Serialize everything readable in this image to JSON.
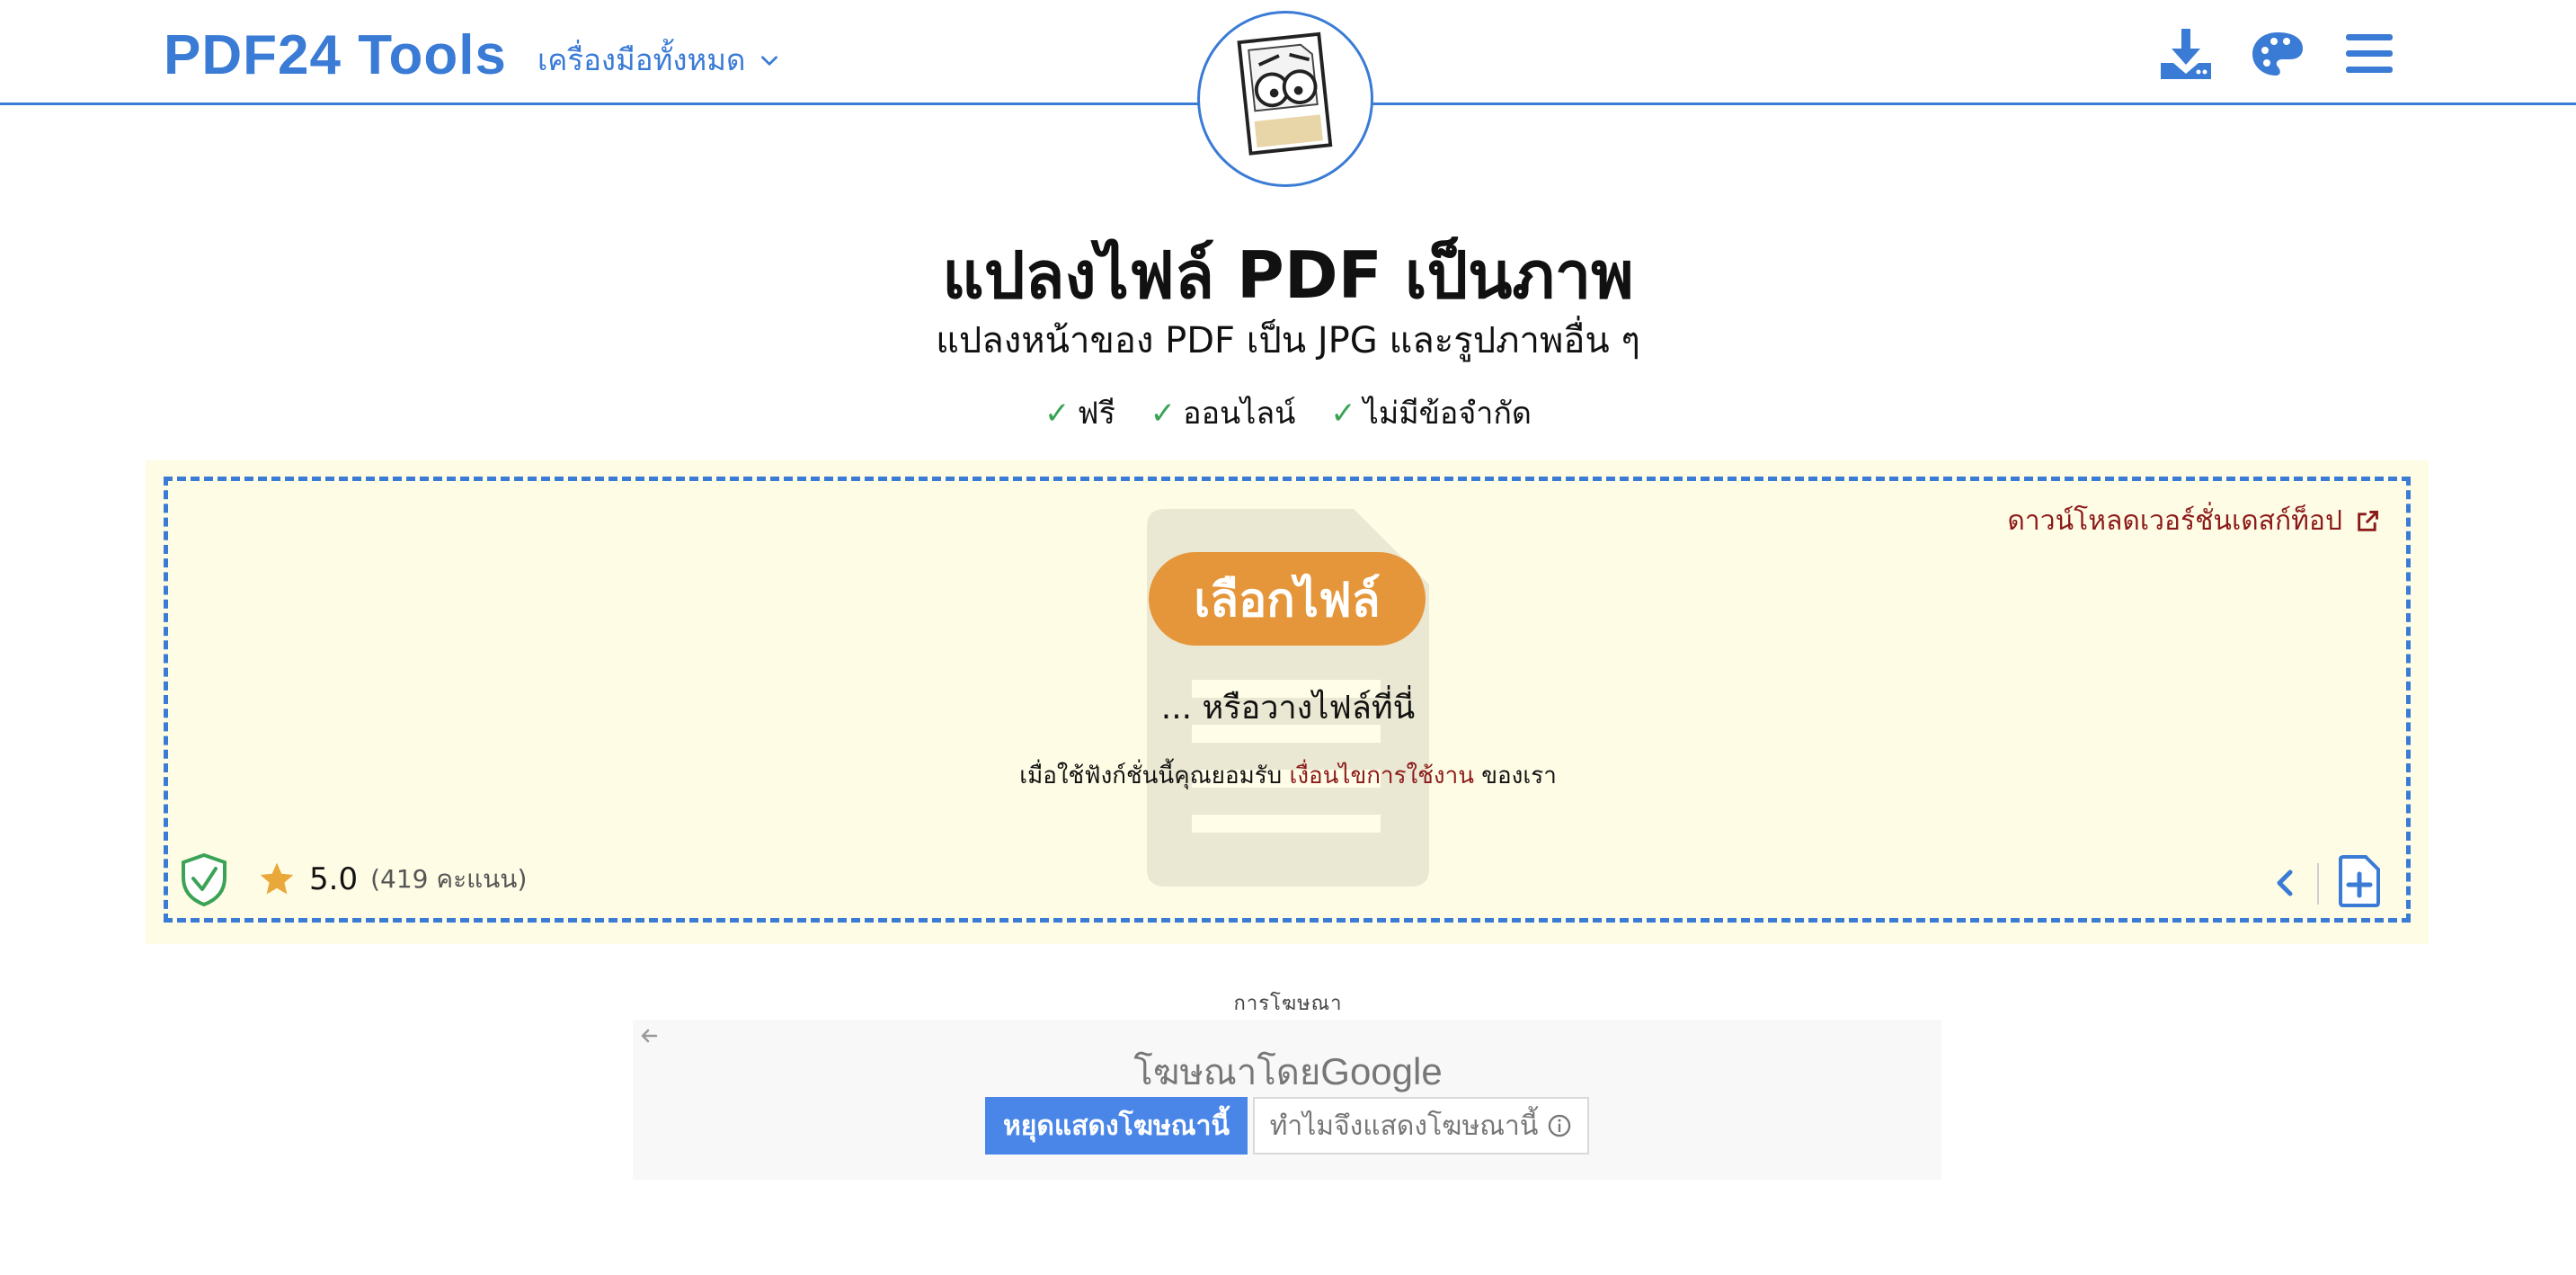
{
  "header": {
    "brand": "PDF24 Tools",
    "all_tools_label": "เครื่องมือทั้งหมด",
    "icons": [
      "download-icon",
      "palette-icon",
      "menu-icon"
    ]
  },
  "page": {
    "title": "แปลงไฟล์ PDF เป็นภาพ",
    "subtitle": "แปลงหน้าของ PDF เป็น JPG และรูปภาพอื่น ๆ",
    "features": [
      "ฟรี",
      "ออนไลน์",
      "ไม่มีข้อจำกัด"
    ],
    "check_mark": "✓"
  },
  "upload": {
    "desktop_link": "ดาวน์โหลดเวอร์ชั่นเดสก์ท็อป",
    "choose_button": "เลือกไฟล์",
    "drop_hint": "... หรือวางไฟล์ที่นี่",
    "terms_prefix": "เมื่อใช้ฟังก์ชั่นนี้คุณยอมรับ",
    "terms_link": "เงื่อนไขการใช้งาน",
    "terms_suffix": "ของเรา",
    "rating_score": "5.0",
    "rating_count": "(419 คะแนน)"
  },
  "ad": {
    "label": "การโฆษณา",
    "by_prefix": "โฆษณาโดย",
    "by_brand": "Google",
    "stop_button": "หยุดแสดงโฆษณานี้",
    "why_button": "ทำไมจึงแสดงโฆษณานี้"
  },
  "colors": {
    "accent": "#3a7bd5",
    "choose_button": "#e5963a",
    "upload_bg": "#fffce5",
    "link_red": "#8b1a1a",
    "check_green": "#3aa356",
    "star": "#e8a83a"
  }
}
